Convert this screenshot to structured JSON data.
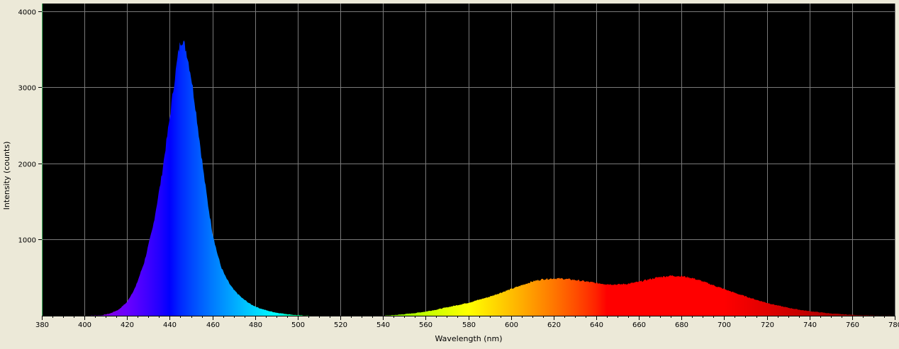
{
  "chart_data": {
    "type": "area",
    "title": "",
    "xlabel": "Wavelength (nm)",
    "ylabel": "Intensity (counts)",
    "xlim": [
      380,
      780
    ],
    "ylim": [
      0,
      4100
    ],
    "grid": true,
    "background": "#000000",
    "grid_color": "#7a7a7a",
    "fill": "spectral colors by wavelength",
    "x_ticks": [
      380,
      400,
      420,
      440,
      460,
      480,
      500,
      520,
      540,
      560,
      580,
      600,
      620,
      640,
      660,
      680,
      700,
      720,
      740,
      760,
      780
    ],
    "y_ticks": [
      1000,
      2000,
      3000,
      4000
    ],
    "x_tick_labels": [
      "380",
      "400",
      "420",
      "440",
      "460",
      "480",
      "500",
      "520",
      "540",
      "560",
      "580",
      "600",
      "620",
      "640",
      "660",
      "680",
      "700",
      "720",
      "740",
      "760",
      "780"
    ],
    "y_tick_labels": [
      "1000",
      "2000",
      "3000",
      "4000"
    ],
    "series": [
      {
        "x": [
          380,
          400,
          408,
          412,
          416,
          420,
          424,
          428,
          432,
          436,
          440,
          442,
          444,
          445,
          446,
          447,
          448,
          450,
          452,
          454,
          456,
          458,
          460,
          462,
          464,
          466,
          468,
          470,
          474,
          478,
          482,
          486,
          490,
          494,
          498,
          502,
          506,
          510,
          520,
          530,
          540,
          545,
          550,
          555,
          560,
          565,
          570,
          575,
          580,
          585,
          590,
          595,
          600,
          605,
          610,
          615,
          620,
          625,
          630,
          635,
          640,
          645,
          650,
          655,
          660,
          665,
          670,
          675,
          680,
          685,
          690,
          695,
          700,
          705,
          710,
          715,
          720,
          725,
          730,
          735,
          740,
          745,
          750,
          755,
          760,
          765,
          770,
          775,
          780
        ],
        "y": [
          0,
          0,
          5,
          30,
          80,
          180,
          380,
          700,
          1150,
          1800,
          2600,
          3050,
          3450,
          3600,
          3620,
          3550,
          3450,
          3150,
          2750,
          2300,
          1850,
          1450,
          1100,
          850,
          650,
          520,
          420,
          340,
          230,
          150,
          100,
          65,
          40,
          25,
          12,
          5,
          0,
          0,
          0,
          0,
          0,
          8,
          20,
          35,
          55,
          80,
          110,
          140,
          170,
          210,
          250,
          300,
          350,
          400,
          450,
          480,
          490,
          485,
          470,
          450,
          430,
          415,
          410,
          420,
          445,
          480,
          510,
          525,
          520,
          495,
          450,
          400,
          350,
          300,
          255,
          210,
          170,
          135,
          105,
          80,
          60,
          45,
          30,
          20,
          12,
          6,
          3,
          1,
          0
        ]
      }
    ]
  }
}
